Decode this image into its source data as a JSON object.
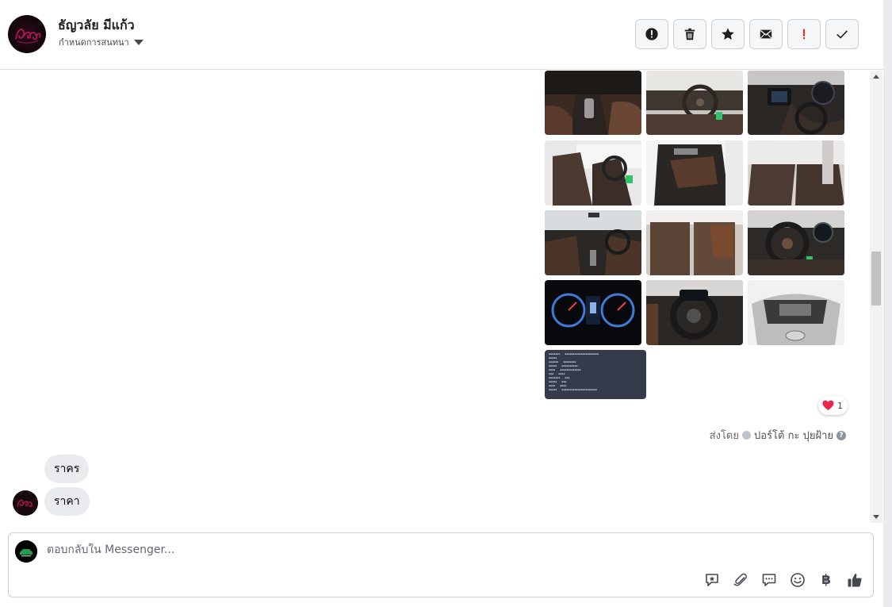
{
  "header": {
    "contact_name": "ธัญวลัย มีแก้ว",
    "assign_label": "กำหนดการสนทนา",
    "avatar_text": "Laems"
  },
  "actions": [
    {
      "name": "report-button",
      "icon": "alert-circle-icon"
    },
    {
      "name": "delete-button",
      "icon": "trash-icon"
    },
    {
      "name": "star-button",
      "icon": "star-icon"
    },
    {
      "name": "mark-unread-button",
      "icon": "envelope-icon"
    },
    {
      "name": "important-button",
      "icon": "exclamation-icon"
    },
    {
      "name": "done-button",
      "icon": "check-icon"
    }
  ],
  "messages": {
    "reaction_count": "1",
    "sent_by_prefix": "ส่งโดย",
    "sent_by_name": "ปอร์โต้ กะ ปุยฝ้าย",
    "incoming": [
      "ราคร",
      "ราคา"
    ]
  },
  "composer": {
    "placeholder": "ตอบกลับใน Messenger..."
  },
  "tools": [
    {
      "name": "saved-reply-tool",
      "icon": "chat-star-icon"
    },
    {
      "name": "attach-tool",
      "icon": "paperclip-icon"
    },
    {
      "name": "quick-reply-tool",
      "icon": "chat-bubble-icon"
    },
    {
      "name": "emoji-tool",
      "icon": "smiley-icon"
    },
    {
      "name": "payment-tool",
      "icon": "baht-icon",
      "glyph": "฿"
    },
    {
      "name": "like-tool",
      "icon": "thumbs-up-icon"
    }
  ],
  "colors": {
    "accent": "#1877f2",
    "bubble": "#e9ebee",
    "important": "#d93025",
    "doc_card": "#353b4a"
  }
}
